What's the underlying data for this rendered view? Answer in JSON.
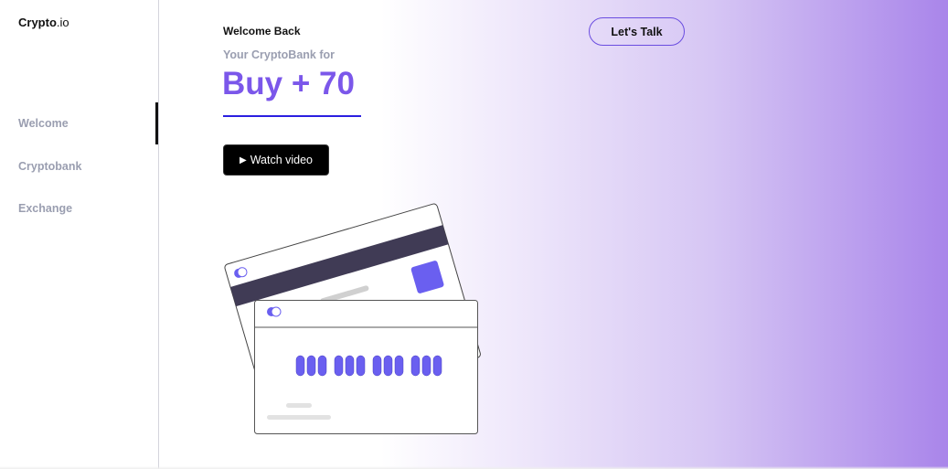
{
  "sidebar": {
    "logo_bold": "Crypto",
    "logo_rest": ".io",
    "items": [
      {
        "label": "Welcome",
        "active": true
      },
      {
        "label": "Cryptobank"
      },
      {
        "label": "Exchange"
      }
    ]
  },
  "hero": {
    "greeting": "Welcome Back",
    "subtitle": "Your CryptoBank for",
    "headline": "Buy + 70",
    "watch_label": "Watch video",
    "play_icon": "▶"
  },
  "header": {
    "cta_label": "Let's Talk"
  },
  "colors": {
    "accent": "#7b57ea",
    "card_accent": "#6a5ff0",
    "stripe": "#403b55"
  }
}
